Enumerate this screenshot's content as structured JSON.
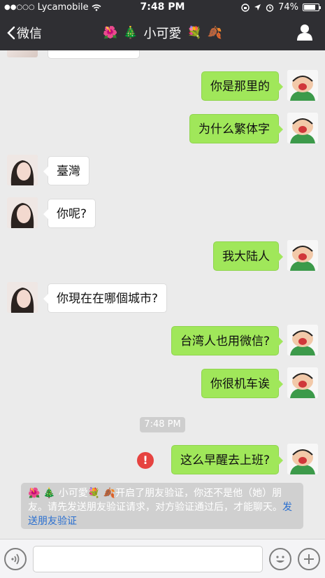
{
  "status_bar": {
    "carrier": "Lycamobile",
    "time": "7:48 PM",
    "battery": "74%"
  },
  "nav": {
    "back_label": "微信",
    "title": "小可愛"
  },
  "messages": [
    {
      "side": "right",
      "text": "你是那里的"
    },
    {
      "side": "right",
      "text": "为什么繁体字"
    },
    {
      "side": "left",
      "text": "臺灣"
    },
    {
      "side": "left",
      "text": "你呢?"
    },
    {
      "side": "right",
      "text": "我大陆人"
    },
    {
      "side": "left",
      "text": "你現在在哪個城市?"
    },
    {
      "side": "right",
      "text": "台湾人也用微信?"
    },
    {
      "side": "right",
      "text": "你很机车诶"
    },
    {
      "side": "right",
      "text": "这么早醒去上班?",
      "failed": true
    }
  ],
  "timestamp": "7:48 PM",
  "error_mark": "!",
  "notice": {
    "name": "小可愛",
    "text": "开启了朋友验证，你还不是他（她）朋友。请先发送朋友验证请求，对方验证通过后，才能聊天。",
    "link": "发送朋友验证"
  },
  "icons": {
    "back": "chevron-left-icon",
    "contact": "person-icon",
    "voice": "voice-icon",
    "emoji": "emoji-icon",
    "more": "plus-icon"
  },
  "colors": {
    "header_bg": "#2f2f33",
    "chat_bg": "#ebebeb",
    "out_bubble": "#a0e75a",
    "in_bubble": "#ffffff",
    "error": "#e64340",
    "link": "#2a6fd0"
  }
}
